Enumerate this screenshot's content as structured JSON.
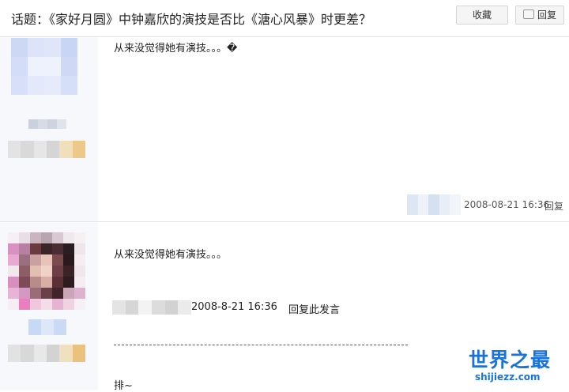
{
  "header": {
    "title": "话题：《家好月圆》中钟嘉欣的演技是否比《溏心风暴》时更差？",
    "collect_label": "收藏",
    "reply_label": "回复"
  },
  "posts": [
    {
      "content": "从来没觉得她有演技。。。�",
      "timestamp": "2008-08-21 16:36",
      "reply_link": "回复"
    },
    {
      "content": "从来没觉得她有演技。。。",
      "quote_time": "2008-8-21 16:36",
      "quote_reply": "回复此发言",
      "separator": "--------------------------------------------------------------------------------",
      "reply_text": "排~"
    }
  ],
  "watermark": {
    "logo_text": "世界之最",
    "domain_text": "shijiezz.com"
  }
}
